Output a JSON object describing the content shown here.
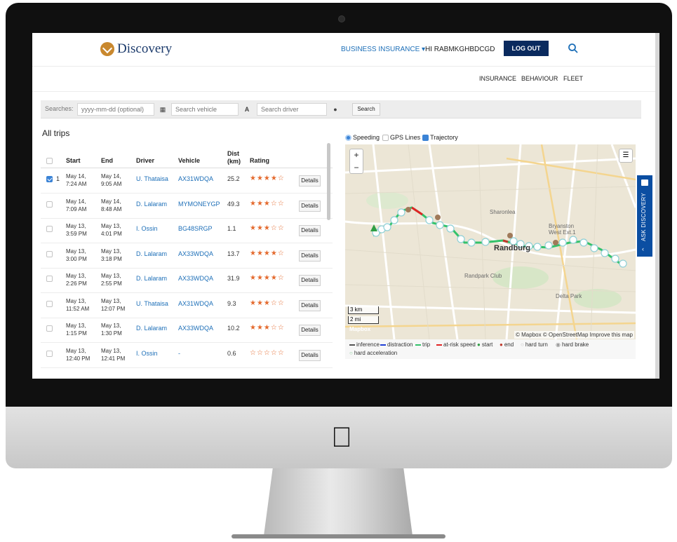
{
  "header": {
    "logo_text": "Discovery",
    "business_menu": "BUSINESS INSURANCE ▾",
    "greeting": "HI RABMKGHBDCGD",
    "logout": "LOG OUT"
  },
  "subnav": [
    "INSURANCE",
    "BEHAVIOUR",
    "FLEET"
  ],
  "search": {
    "label": "Searches:",
    "date_placeholder": "yyyy-mm-dd (optional)",
    "vehicle_placeholder": "Search vehicle",
    "driver_placeholder": "Search driver",
    "button": "Search"
  },
  "trips": {
    "title": "All trips",
    "columns": [
      "Start",
      "End",
      "Driver",
      "Vehicle",
      "Dist (km)",
      "Rating"
    ],
    "details_label": "Details",
    "rows": [
      {
        "selected": true,
        "index": "1",
        "start": [
          "May 14,",
          "7:24 AM"
        ],
        "end": [
          "May 14,",
          "9:05 AM"
        ],
        "driver": "U. Thataisa",
        "vehicle": "AX31WDQA",
        "dist": "25.2",
        "rating": "★★★★☆"
      },
      {
        "selected": false,
        "index": "",
        "start": [
          "May 14,",
          "7:09 AM"
        ],
        "end": [
          "May 14,",
          "8:48 AM"
        ],
        "driver": "D. Lalaram",
        "vehicle": "MYMONEYGP",
        "dist": "49.3",
        "rating": "★★★☆☆"
      },
      {
        "selected": false,
        "index": "",
        "start": [
          "May 13,",
          "3:59 PM"
        ],
        "end": [
          "May 13,",
          "4:01 PM"
        ],
        "driver": "I. Ossin",
        "vehicle": "BG48SRGP",
        "dist": "1.1",
        "rating": "★★★☆☆"
      },
      {
        "selected": false,
        "index": "",
        "start": [
          "May 13,",
          "3:00 PM"
        ],
        "end": [
          "May 13,",
          "3:18 PM"
        ],
        "driver": "D. Lalaram",
        "vehicle": "AX33WDQA",
        "dist": "13.7",
        "rating": "★★★★☆"
      },
      {
        "selected": false,
        "index": "",
        "start": [
          "May 13,",
          "2:26 PM"
        ],
        "end": [
          "May 13,",
          "2:55 PM"
        ],
        "driver": "D. Lalaram",
        "vehicle": "AX33WDQA",
        "dist": "31.9",
        "rating": "★★★★☆"
      },
      {
        "selected": false,
        "index": "",
        "start": [
          "May 13,",
          "11:52 AM"
        ],
        "end": [
          "May 13,",
          "12:07 PM"
        ],
        "driver": "U. Thataisa",
        "vehicle": "AX31WDQA",
        "dist": "9.3",
        "rating": "★★★☆☆"
      },
      {
        "selected": false,
        "index": "",
        "start": [
          "May 13,",
          "1:15 PM"
        ],
        "end": [
          "May 13,",
          "1:30 PM"
        ],
        "driver": "D. Lalaram",
        "vehicle": "AX33WDQA",
        "dist": "10.2",
        "rating": "★★★☆☆"
      },
      {
        "selected": false,
        "index": "",
        "start": [
          "May 13,",
          "12:40 PM"
        ],
        "end": [
          "May 13,",
          "12:41 PM"
        ],
        "driver": "I. Ossin",
        "vehicle": "-",
        "dist": "0.6",
        "rating": "☆☆☆☆☆"
      }
    ]
  },
  "map": {
    "options": {
      "speeding": "Speeding",
      "gps_lines": "GPS Lines",
      "trajectory": "Trajectory"
    },
    "scale_km": "3 km",
    "scale_mi": "2 mi",
    "attribution": "© Mapbox © OpenStreetMap Improve this map",
    "labels": [
      "Randburg",
      "Sharonlea",
      "Bryanston West Ext.1",
      "Randpark Club",
      "Delta Park",
      "Mapbox"
    ],
    "legend": [
      {
        "label": "inference",
        "color": "#555555"
      },
      {
        "label": "distraction",
        "color": "#1f3fd6"
      },
      {
        "label": "trip",
        "color": "#33c26a"
      },
      {
        "label": "at-risk speed",
        "color": "#e02424"
      },
      {
        "label": "start",
        "color": "#2f9e44"
      },
      {
        "label": "end",
        "color": "#c0392b"
      },
      {
        "label": "hard turn",
        "color": "#bbbbbb"
      },
      {
        "label": "hard brake",
        "color": "#999999"
      },
      {
        "label": "hard acceleration",
        "color": "#88cc99"
      }
    ]
  },
  "ask_tab": "ASK DISCOVERY",
  "colors": {
    "brand_navy": "#0a2a5e",
    "link_blue": "#1d6fb8",
    "star_orange": "#e46a2e",
    "tab_blue": "#0b4ea2"
  }
}
